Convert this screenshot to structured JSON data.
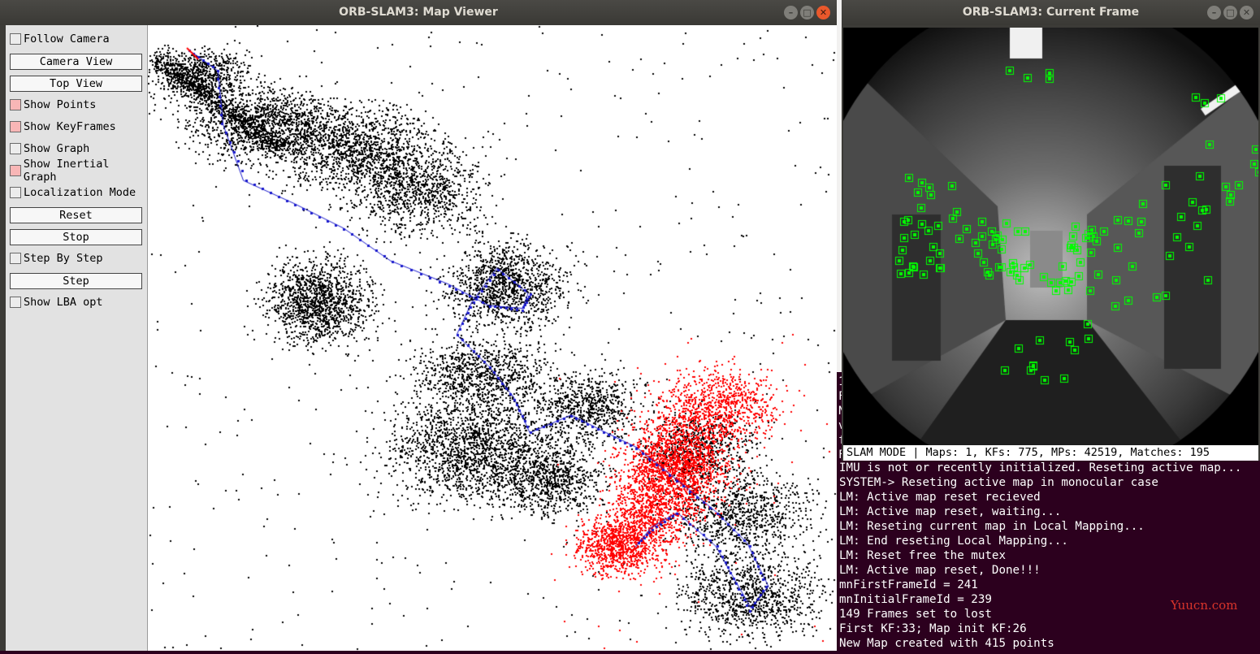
{
  "map_viewer": {
    "title": "ORB-SLAM3: Map Viewer",
    "controls": [
      {
        "type": "checkbox",
        "label": "Follow Camera",
        "checked": false
      },
      {
        "type": "button",
        "label": "Camera View"
      },
      {
        "type": "button",
        "label": "Top View"
      },
      {
        "type": "checkbox",
        "label": "Show Points",
        "checked": true
      },
      {
        "type": "checkbox",
        "label": "Show KeyFrames",
        "checked": true
      },
      {
        "type": "checkbox",
        "label": "Show Graph",
        "checked": false
      },
      {
        "type": "checkbox",
        "label": "Show Inertial Graph",
        "checked": true
      },
      {
        "type": "checkbox",
        "label": "Localization Mode",
        "checked": false
      },
      {
        "type": "button",
        "label": "Reset"
      },
      {
        "type": "button",
        "label": "Stop"
      },
      {
        "type": "checkbox",
        "label": "Step By Step",
        "checked": false
      },
      {
        "type": "button",
        "label": "Step"
      },
      {
        "type": "checkbox",
        "label": "Show LBA opt",
        "checked": false
      }
    ],
    "colors": {
      "points": "#000000",
      "local_points": "#ff0000",
      "trajectory": "#1a1acc",
      "checked": "#f8b6b6"
    }
  },
  "current_frame": {
    "title": "ORB-SLAM3: Current Frame",
    "status": "SLAM MODE |  Maps: 1, KFs: 775, MPs: 42519, Matches: 195",
    "feature_color": "#00ff00"
  },
  "terminal": {
    "lines": [
      "IMU is not or recently initialized. Reseting active map...",
      "SYSTEM-> Reseting active map in monocular case",
      "LM: Active map reset recieved",
      "LM: Active map reset, waiting...",
      "LM: Reseting current map in Local Mapping...",
      "LM: End reseting Local Mapping...",
      "LM: Reset free the mutex",
      "LM: Active map reset, Done!!!",
      "mnFirstFrameId = 241",
      "mnInitialFrameId = 239",
      "149 Frames set to lost",
      "First KF:33; Map init KF:26",
      "New Map created with 415 points"
    ],
    "hidden_edge_chars": [
      "1",
      "F",
      "N",
      "v",
      "f",
      "F"
    ]
  },
  "watermark": "Yuucn.com"
}
